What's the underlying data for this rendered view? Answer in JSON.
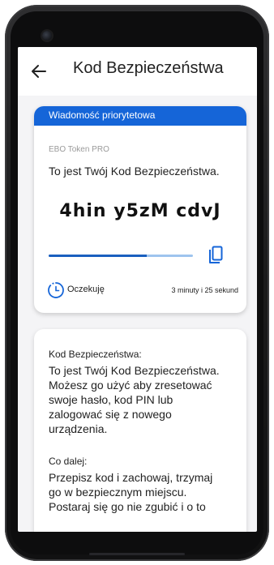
{
  "app_bar": {
    "back_icon": "arrow-left-icon",
    "title": "Kod Bezpieczeństwa"
  },
  "priority_card": {
    "header": "Wiadomość priorytetowa",
    "header_color": "#1565d8",
    "subtitle": "EBO Token PRO",
    "info": "To jest Twój Kod Bezpieczeństwa.",
    "code": "4hin y5zM cdvJ",
    "copy_icon": "copy-icon",
    "progress_fraction": 0.68,
    "status_icon": "clock-icon",
    "status": "Oczekuję",
    "time_remaining": "3 minuty i 25 sekund"
  },
  "details_card": {
    "section1_title": "Kod Bezpieczeństwa:",
    "section1_lines": [
      "To jest Twój Kod Bezpieczeństwa.",
      "Możesz go użyć aby zresetować",
      "swoje hasło, kod PIN lub",
      "zalogować się z nowego",
      "urządzenia."
    ],
    "section2_title": "Co dalej:",
    "section2_lines": [
      "Przepisz kod i zachowaj, trzymaj",
      "go w bezpiecznym miejscu.",
      "Postaraj się go nie zgubić i o to"
    ]
  }
}
